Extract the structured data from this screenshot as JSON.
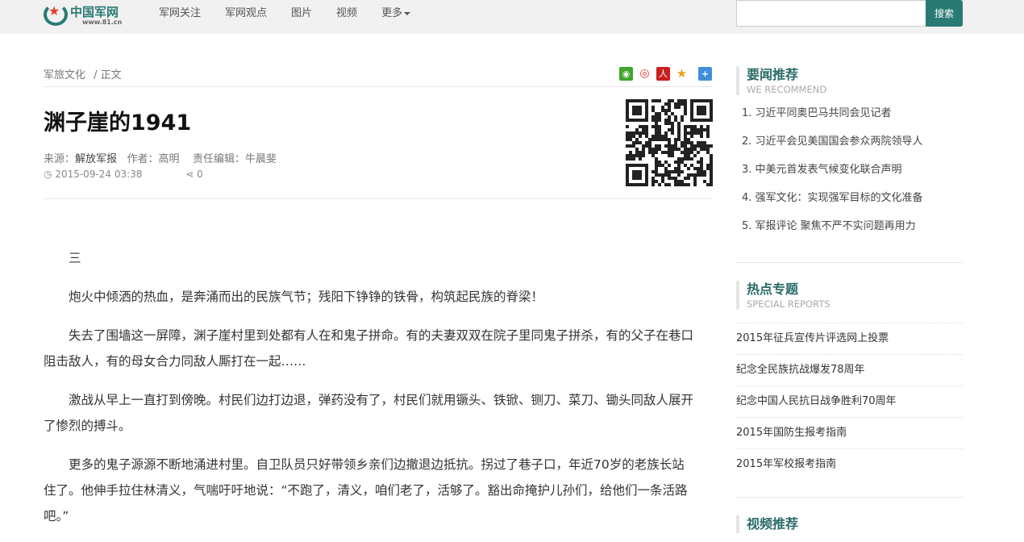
{
  "header": {
    "logo_text": "中国军网",
    "logo_url_text": "www.81.cn",
    "nav": [
      "军网关注",
      "军网观点",
      "图片",
      "视频",
      "更多"
    ],
    "search_placeholder": "",
    "search_button": "搜索"
  },
  "breadcrumb": {
    "section": "军旅文化",
    "current": "/ 正文"
  },
  "share_icons": [
    "wechat-icon",
    "weibo-icon",
    "renmin-icon",
    "qzone-icon",
    "more-share-icon"
  ],
  "article": {
    "title": "渊子崖的1941",
    "source_label": "来源：",
    "source": "解放军报",
    "author_label": "作者：",
    "author": "高明",
    "editor_label": "责任编辑：",
    "editor": "牛晨斐",
    "datetime": "2015-09-24 03:38",
    "share_count": "0",
    "paragraphs": [
      "三",
      "炮火中倾洒的热血，是奔涌而出的民族气节；残阳下铮铮的铁骨，构筑起民族的脊梁！",
      "失去了围墙这一屏障，渊子崖村里到处都有人在和鬼子拼命。有的夫妻双双在院子里同鬼子拼杀，有的父子在巷口阻击敌人，有的母女合力同敌人厮打在一起……",
      "激战从早上一直打到傍晚。村民们边打边退，弹药没有了，村民们就用镢头、铁锨、铡刀、菜刀、锄头同敌人展开了惨烈的搏斗。",
      "更多的鬼子源源不断地涌进村里。自卫队员只好带领乡亲们边撤退边抵抗。拐过了巷子口，年近70岁的老族长站住了。他伸手拉住林清义，气喘吁吁地说：“不跑了，清义，咱们老了，活够了。豁出命掩护儿孙们，给他们一条活路吧。”"
    ]
  },
  "sidebar": {
    "recommend": {
      "title": "要闻推荐",
      "subtitle": "WE RECOMMEND",
      "items": [
        "1. 习近平同奥巴马共同会见记者",
        "2. 习近平会见美国国会参众两院领导人",
        "3. 中美元首发表气候变化联合声明",
        "4. 强军文化：实现强军目标的文化准备",
        "5. 军报评论 聚焦不严不实问题再用力"
      ]
    },
    "special": {
      "title": "热点专题",
      "subtitle": "SPECIAL REPORTS",
      "items": [
        "2015年征兵宣传片评选网上投票",
        "纪念全民族抗战爆发78周年",
        "纪念中国人民抗日战争胜利70周年",
        "2015年国防生报考指南",
        "2015年军校报考指南"
      ]
    },
    "video": {
      "title": "视频推荐"
    }
  }
}
